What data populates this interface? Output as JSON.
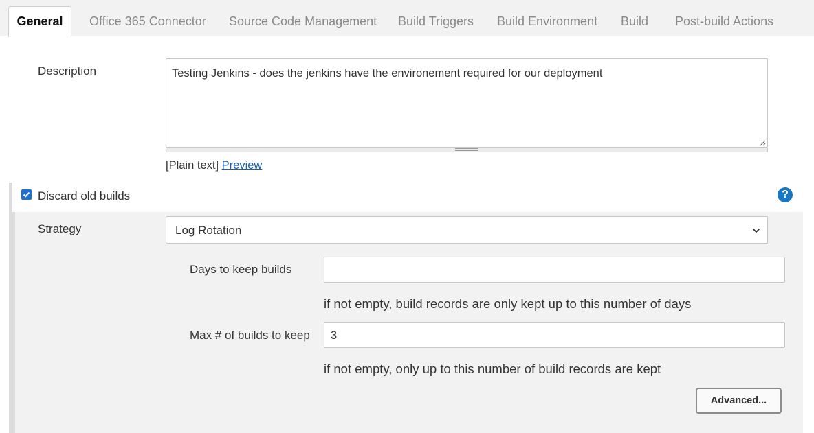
{
  "tabs": [
    {
      "label": "General",
      "active": true
    },
    {
      "label": "Office 365 Connector"
    },
    {
      "label": "Source Code Management"
    },
    {
      "label": "Build Triggers"
    },
    {
      "label": "Build Environment"
    },
    {
      "label": "Build"
    },
    {
      "label": "Post-build Actions"
    }
  ],
  "description": {
    "label": "Description",
    "value": "Testing Jenkins - does the jenkins have the environement required for our deployment",
    "format": "[Plain text]",
    "preview_link": "Preview"
  },
  "discard": {
    "checkbox_label": "Discard old builds",
    "checked": true,
    "help_icon": "question-mark-icon",
    "strategy_label": "Strategy",
    "strategy_value": "Log Rotation",
    "days_label": "Days to keep builds",
    "days_value": "",
    "days_hint": "if not empty, build records are only kept up to this number of days",
    "max_label": "Max # of builds to keep",
    "max_value": "3",
    "max_hint": "if not empty, only up to this number of build records are kept",
    "advanced_button": "Advanced..."
  },
  "colors": {
    "accent": "#1f6fd1",
    "link": "#1a5fb4",
    "panel": "#f2f2f2"
  }
}
